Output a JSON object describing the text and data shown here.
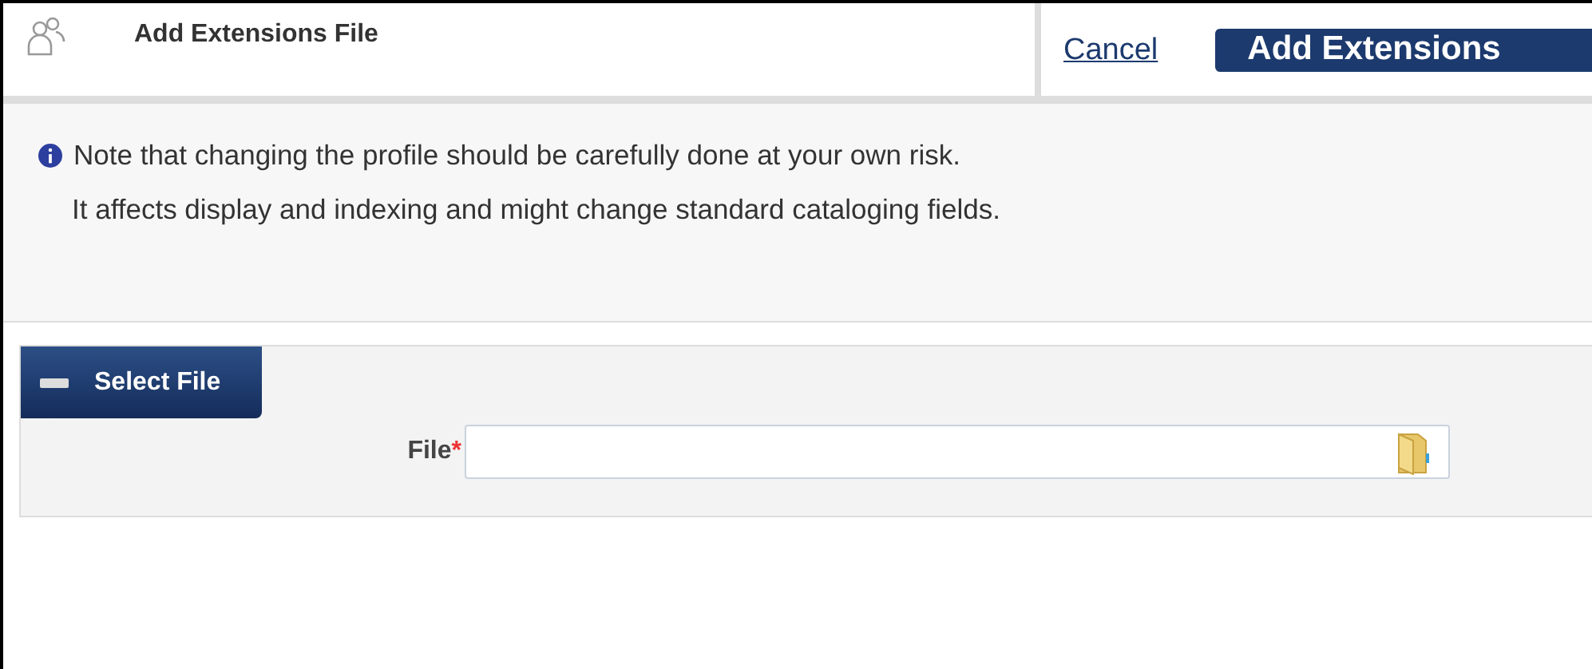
{
  "header": {
    "title": "Add Extensions File",
    "cancel": "Cancel",
    "submit": "Add Extensions"
  },
  "note": {
    "lines": [
      "Note that changing the profile should be carefully done at your own risk.",
      "It affects display and indexing and might change standard cataloging fields."
    ]
  },
  "section": {
    "title": "Select File",
    "expanded": true,
    "fields": [
      {
        "label": "File",
        "required": true,
        "required_mark": "*"
      }
    ]
  }
}
